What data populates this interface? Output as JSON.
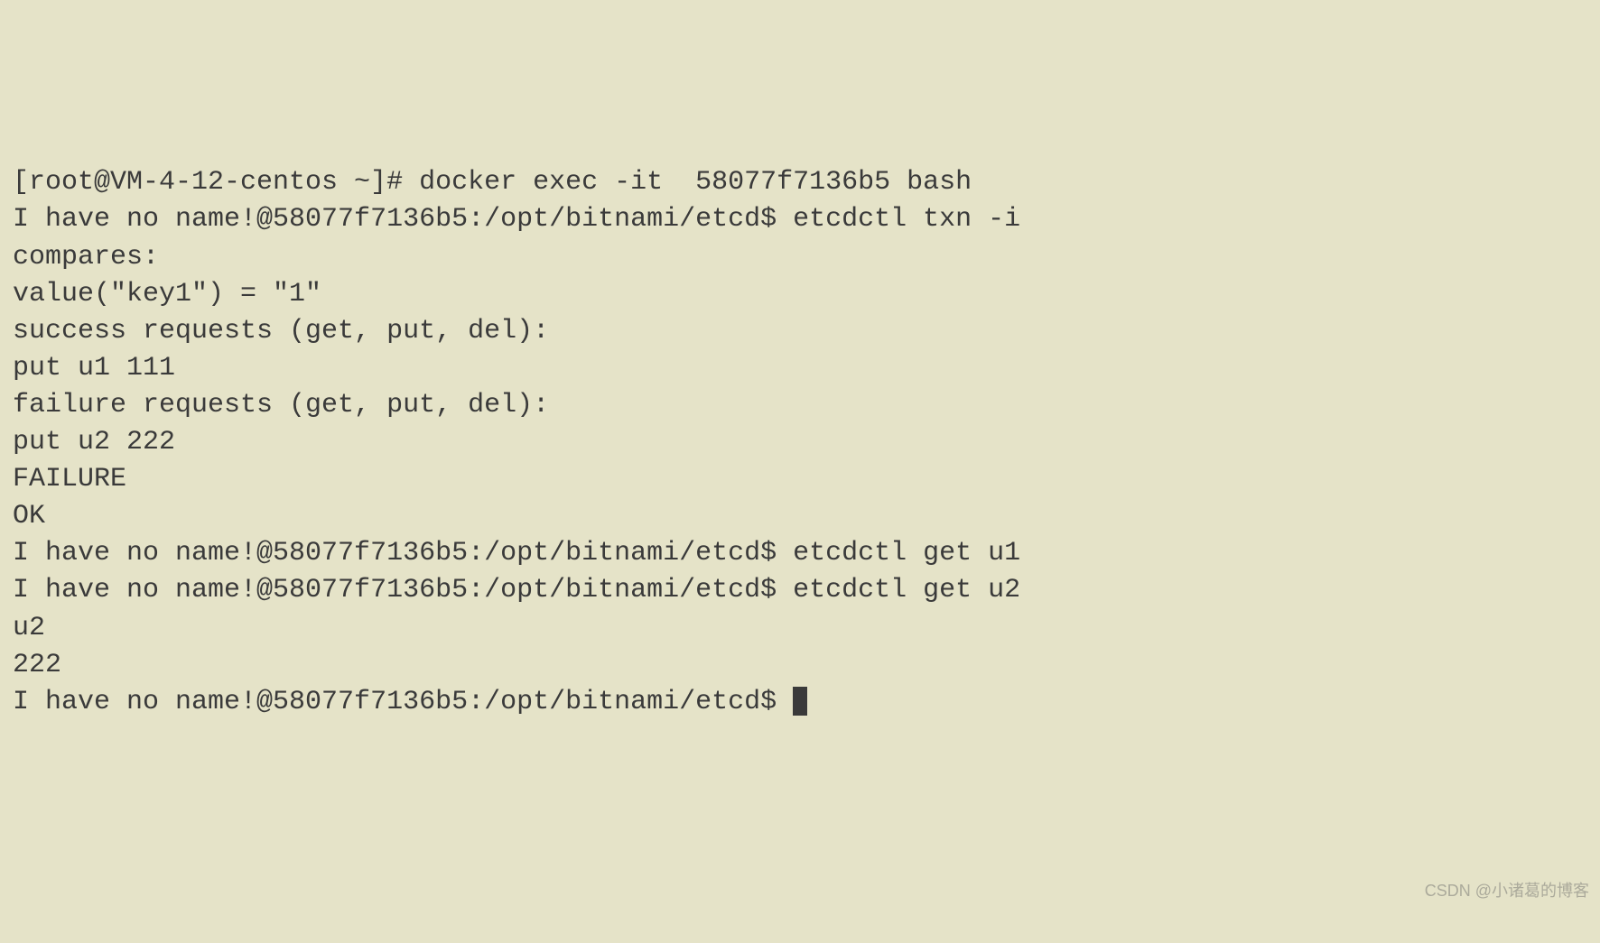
{
  "terminal": {
    "lines": [
      {
        "text": "[root@VM-4-12-centos ~]# docker exec -it  58077f7136b5 bash"
      },
      {
        "text": "I have no name!@58077f7136b5:/opt/bitnami/etcd$ etcdctl txn -i"
      },
      {
        "text": "compares:"
      },
      {
        "text": "value(\"key1\") = \"1\""
      },
      {
        "text": ""
      },
      {
        "text": "success requests (get, put, del):"
      },
      {
        "text": "put u1 111"
      },
      {
        "text": ""
      },
      {
        "text": "failure requests (get, put, del):"
      },
      {
        "text": "put u2 222"
      },
      {
        "text": ""
      },
      {
        "text": "FAILURE"
      },
      {
        "text": ""
      },
      {
        "text": "OK"
      },
      {
        "text": "I have no name!@58077f7136b5:/opt/bitnami/etcd$ etcdctl get u1"
      },
      {
        "text": "I have no name!@58077f7136b5:/opt/bitnami/etcd$ etcdctl get u2"
      },
      {
        "text": "u2"
      },
      {
        "text": "222"
      },
      {
        "text": "I have no name!@58077f7136b5:/opt/bitnami/etcd$ ",
        "cursor": true
      }
    ]
  },
  "watermark": "CSDN @小诸葛的博客"
}
